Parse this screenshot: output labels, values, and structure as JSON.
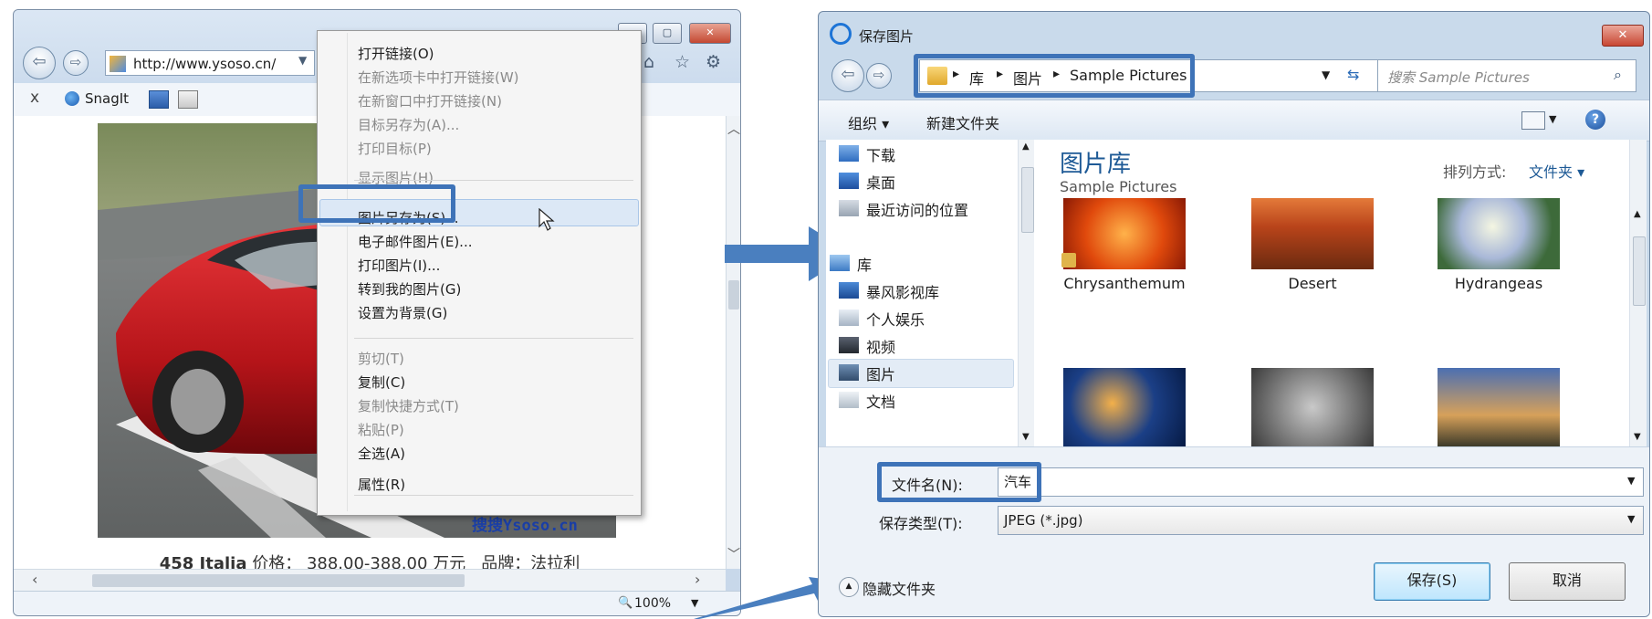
{
  "browser": {
    "url": "http://www.ysoso.cn/",
    "bookmarks": {
      "close_label": "x",
      "snagit_label": "SnagIt"
    },
    "caption": {
      "model": "458 Italia",
      "price_label": "价格：",
      "price": "388.00-388.00 万元",
      "brand_label": "品牌：",
      "brand": "法拉利"
    },
    "watermark": "搜搜Ysoso.cn",
    "zoom": "100%"
  },
  "context_menu": {
    "items": [
      {
        "label": "打开链接(O)",
        "enabled": true
      },
      {
        "label": "在新选项卡中打开链接(W)",
        "enabled": false
      },
      {
        "label": "在新窗口中打开链接(N)",
        "enabled": false
      },
      {
        "label": "目标另存为(A)...",
        "enabled": false
      },
      {
        "label": "打印目标(P)",
        "enabled": false
      },
      {
        "label": "显示图片(H)",
        "enabled": false
      },
      {
        "label": "图片另存为(S)...",
        "enabled": true,
        "highlighted": true
      },
      {
        "label": "电子邮件图片(E)...",
        "enabled": true
      },
      {
        "label": "打印图片(I)...",
        "enabled": true
      },
      {
        "label": "转到我的图片(G)",
        "enabled": true
      },
      {
        "label": "设置为背景(G)",
        "enabled": true
      },
      {
        "label": "剪切(T)",
        "enabled": false
      },
      {
        "label": "复制(C)",
        "enabled": true
      },
      {
        "label": "复制快捷方式(T)",
        "enabled": false
      },
      {
        "label": "粘贴(P)",
        "enabled": false
      },
      {
        "label": "全选(A)",
        "enabled": true
      },
      {
        "label": "属性(R)",
        "enabled": true
      }
    ]
  },
  "dialog": {
    "title": "保存图片",
    "breadcrumb": [
      "库",
      "图片",
      "Sample Pictures"
    ],
    "search_placeholder": "搜索 Sample Pictures",
    "toolbar": {
      "organize": "组织 ▾",
      "new_folder": "新建文件夹"
    },
    "nav": {
      "favorites": [
        "下载",
        "桌面",
        "最近访问的位置"
      ],
      "library_label": "库",
      "libraries": [
        "暴风影视库",
        "个人娱乐",
        "视频",
        "图片",
        "文档"
      ]
    },
    "library": {
      "title": "图片库",
      "subtitle": "Sample Pictures",
      "sort_label": "排列方式:",
      "sort_value": "文件夹 ▾"
    },
    "files": [
      "Chrysanthemum",
      "Desert",
      "Hydrangeas"
    ],
    "filename_label": "文件名(N):",
    "filename_value": "汽车",
    "filetype_label": "保存类型(T):",
    "filetype_value": "JPEG (*.jpg)",
    "hide_folders": "隐藏文件夹",
    "save_button": "保存(S)",
    "cancel_button": "取消"
  },
  "colors": {
    "highlight_box": "#3e73b8",
    "arrow": "#4a7fbf"
  }
}
